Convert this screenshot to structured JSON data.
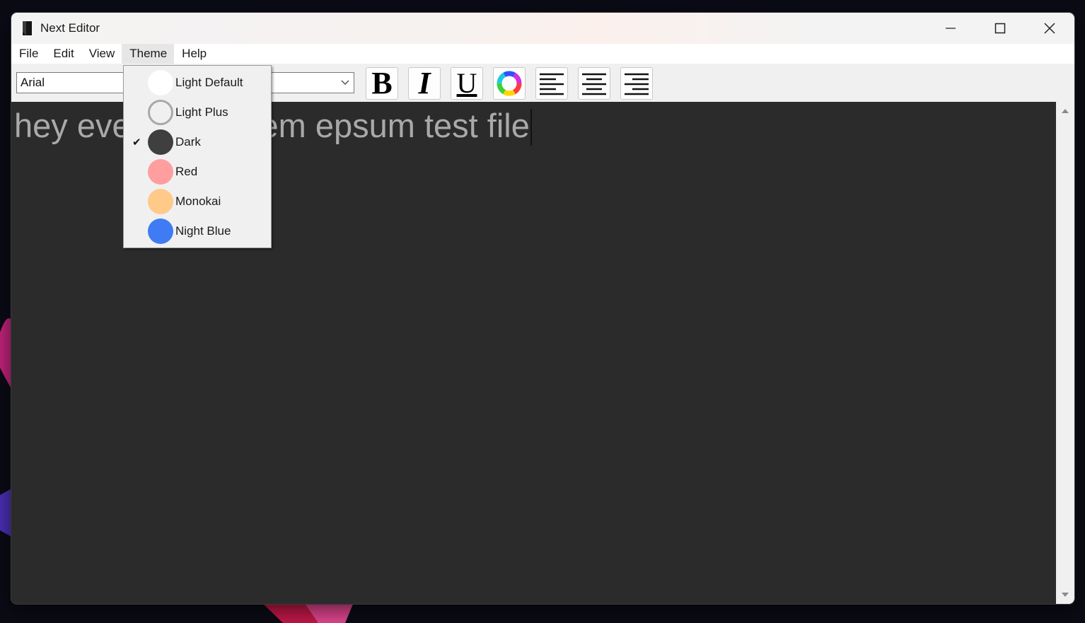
{
  "window": {
    "title": "Next Editor"
  },
  "menubar": {
    "items": [
      "File",
      "Edit",
      "View",
      "Theme",
      "Help"
    ]
  },
  "toolbar": {
    "font_family_value": "Arial",
    "bold_label": "B",
    "italic_label": "I",
    "underline_label": "U"
  },
  "editor": {
    "text": "hey everyone lorem epsum test file"
  },
  "theme_menu": {
    "items": [
      {
        "label": "Light Default",
        "color": "#ffffff",
        "checked": false
      },
      {
        "label": "Light Plus",
        "color": "#f0f0f0",
        "checked": false
      },
      {
        "label": "Dark",
        "color": "#3f3f3f",
        "checked": true
      },
      {
        "label": "Red",
        "color": "#ff9e9e",
        "checked": false
      },
      {
        "label": "Monokai",
        "color": "#ffc98a",
        "checked": false
      },
      {
        "label": "Night Blue",
        "color": "#3f7bf2",
        "checked": false
      }
    ],
    "check_glyph": "✔"
  }
}
